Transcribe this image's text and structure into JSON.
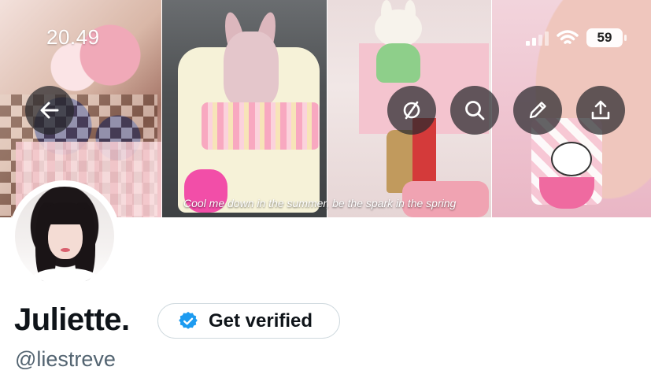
{
  "status_bar": {
    "time": "20.49",
    "battery": "59"
  },
  "banner": {
    "caption": "Cool me down in the summer, be the spark in the spring"
  },
  "header_actions": {
    "back": "back-arrow-icon",
    "sync": "sync-icon",
    "search": "search-icon",
    "edit": "pencil-icon",
    "share": "share-icon"
  },
  "profile": {
    "display_name": "Juliette.",
    "handle": "@liestreve",
    "verify_label": "Get verified"
  },
  "colors": {
    "verified_blue": "#1d9bf0",
    "text_primary": "#0f1419",
    "text_secondary": "#536471",
    "button_border": "#cfd9de"
  }
}
